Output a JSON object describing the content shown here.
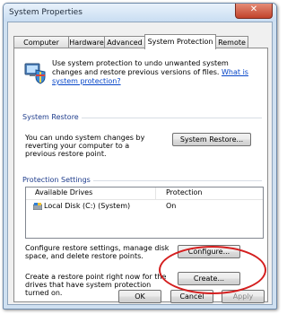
{
  "window": {
    "title": "System Properties",
    "close_glyph": "✕"
  },
  "tabs": [
    {
      "label": "Computer Name"
    },
    {
      "label": "Hardware"
    },
    {
      "label": "Advanced"
    },
    {
      "label": "System Protection",
      "active": true
    },
    {
      "label": "Remote"
    }
  ],
  "intro": {
    "text": "Use system protection to undo unwanted system changes and restore previous versions of files.",
    "link": "What is system protection?",
    "icon": "shield-icon"
  },
  "system_restore": {
    "heading": "System Restore",
    "description": "You can undo system changes by reverting your computer to a previous restore point.",
    "button": "System Restore..."
  },
  "protection_settings": {
    "heading": "Protection Settings",
    "columns": [
      "Available Drives",
      "Protection"
    ],
    "drives": [
      {
        "name": "Local Disk (C:) (System)",
        "protection": "On",
        "icon": "drive-icon"
      }
    ],
    "configure_text": "Configure restore settings, manage disk space, and delete restore points.",
    "configure_button": "Configure...",
    "create_text": "Create a restore point right now for the drives that have system protection turned on.",
    "create_button": "Create...",
    "annotation_color": "#d41f1f"
  },
  "footer": {
    "ok": "OK",
    "cancel": "Cancel",
    "apply": "Apply"
  }
}
